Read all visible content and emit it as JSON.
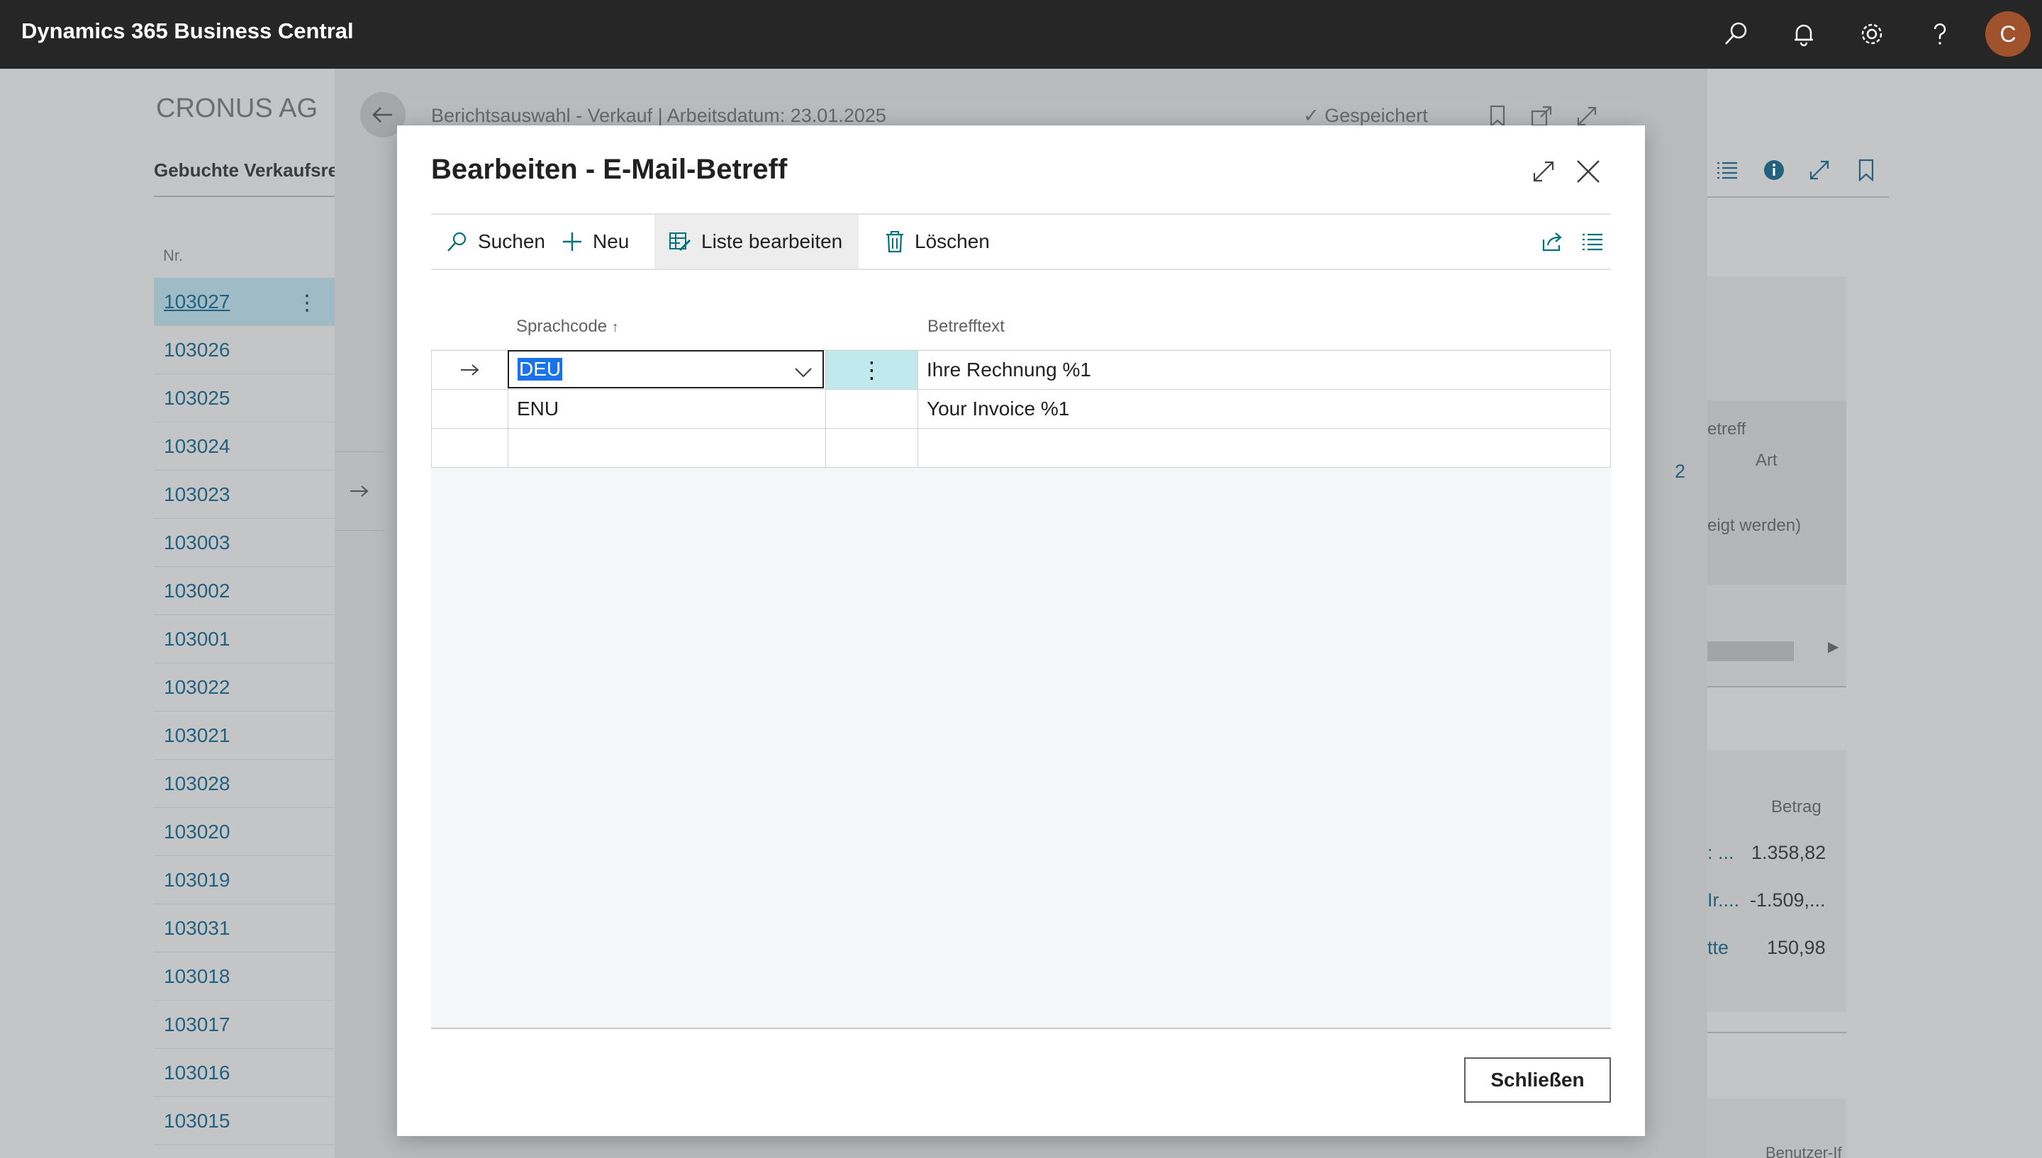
{
  "app": {
    "title": "Dynamics 365 Business Central",
    "user_initial": "C"
  },
  "topbar_icons": [
    "search-icon",
    "bell-icon",
    "gear-icon",
    "help-icon"
  ],
  "background": {
    "company": "CRONUS AG",
    "pane_title": "Gebuchte Verkaufsrechnungen",
    "column_header": "Nr.",
    "rows": [
      "103027",
      "103026",
      "103025",
      "103024",
      "103023",
      "103003",
      "103002",
      "103001",
      "103022",
      "103021",
      "103028",
      "103020",
      "103019",
      "103031",
      "103018",
      "103017",
      "103016",
      "103015"
    ]
  },
  "middle_page": {
    "breadcrumb": "Berichtsauswahl - Verkauf | Arbeitsdatum: 23.01.2025",
    "saved_label": "Gespeichert"
  },
  "right_panel": {
    "betreff_label": "etreff",
    "betreff_value": "2",
    "art_label": "Art",
    "hint": "eigt werden)",
    "betrag_header": "Betrag",
    "lines": [
      {
        "label": ": ...",
        "amount": "1.358,82"
      },
      {
        "label": "Ir....",
        "amount": "-1.509,..."
      },
      {
        "label": "tte",
        "amount": "150,98"
      }
    ],
    "bottom_label": "Benutzer-If"
  },
  "modal": {
    "title": "Bearbeiten - E-Mail-Betreff",
    "actions": {
      "search": "Suchen",
      "new": "Neu",
      "edit_list": "Liste bearbeiten",
      "delete": "Löschen"
    },
    "columns": {
      "language": "Sprachcode",
      "subject": "Betrefftext"
    },
    "rows": [
      {
        "language": "DEU",
        "subject": "Ihre Rechnung %1"
      },
      {
        "language": "ENU",
        "subject": "Your Invoice %1"
      }
    ],
    "close_label": "Schließen"
  },
  "colors": {
    "topbar": "#262626",
    "accent": "#00707a",
    "link": "#24617e",
    "avatar": "#a0522d",
    "selected_cell": "#bfe9ec"
  }
}
